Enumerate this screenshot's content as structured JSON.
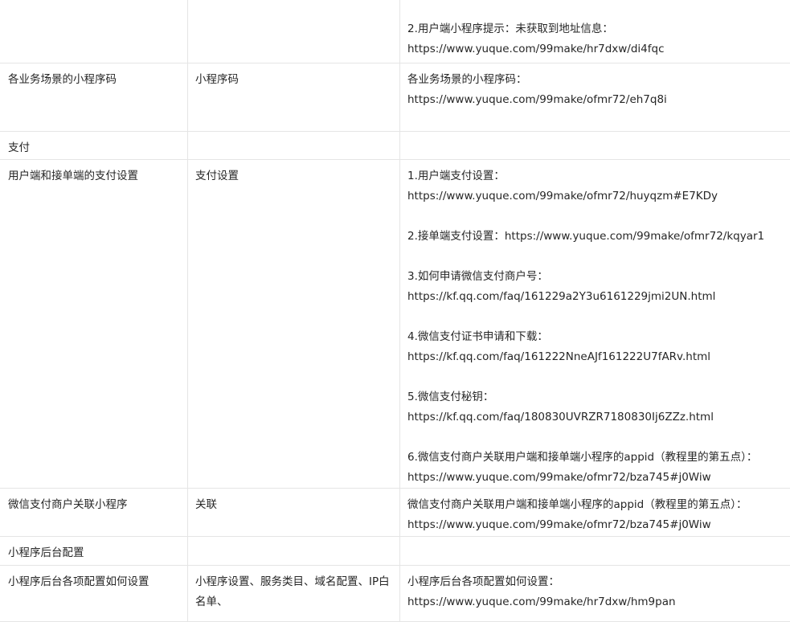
{
  "rows": [
    {
      "feature": "",
      "setting": "",
      "guide": [
        "",
        "2.用户端小程序提示：未获取到地址信息：",
        "https://www.yuque.com/99make/hr7dxw/di4fqc"
      ]
    },
    {
      "feature": "各业务场景的小程序码",
      "setting": "小程序码",
      "guide": [
        "各业务场景的小程序码：",
        "https://www.yuque.com/99make/ofmr72/eh7q8i"
      ]
    },
    {
      "feature": "支付",
      "setting": "",
      "guide": []
    },
    {
      "feature": "用户端和接单端的支付设置",
      "setting": "支付设置",
      "guide": [
        "1.用户端支付设置：",
        "https://www.yuque.com/99make/ofmr72/huyqzm#E7KDy",
        "",
        "2.接单端支付设置：https://www.yuque.com/99make/ofmr72/kqyar1",
        "",
        "3.如何申请微信支付商户号：",
        "https://kf.qq.com/faq/161229a2Y3u6161229jmi2UN.html",
        "",
        "4.微信支付证书申请和下载：",
        "https://kf.qq.com/faq/161222NneAJf161222U7fARv.html",
        "",
        "5.微信支付秘钥：",
        "https://kf.qq.com/faq/180830UVRZR7180830Ij6ZZz.html",
        "",
        "6.微信支付商户关联用户端和接单端小程序的appid（教程里的第五点）：",
        "https://www.yuque.com/99make/ofmr72/bza745#j0Wiw"
      ]
    },
    {
      "feature": "微信支付商户关联小程序",
      "setting": "关联",
      "guide": [
        "微信支付商户关联用户端和接单端小程序的appid（教程里的第五点）：",
        "https://www.yuque.com/99make/ofmr72/bza745#j0Wiw"
      ]
    },
    {
      "feature": "小程序后台配置",
      "setting": "",
      "guide": []
    },
    {
      "feature": "小程序后台各项配置如何设置",
      "setting": "小程序设置、服务类目、域名配置、IP白名单、",
      "guide": [
        "小程序后台各项配置如何设置：",
        "https://www.yuque.com/99make/hr7dxw/hm9pan"
      ]
    }
  ]
}
